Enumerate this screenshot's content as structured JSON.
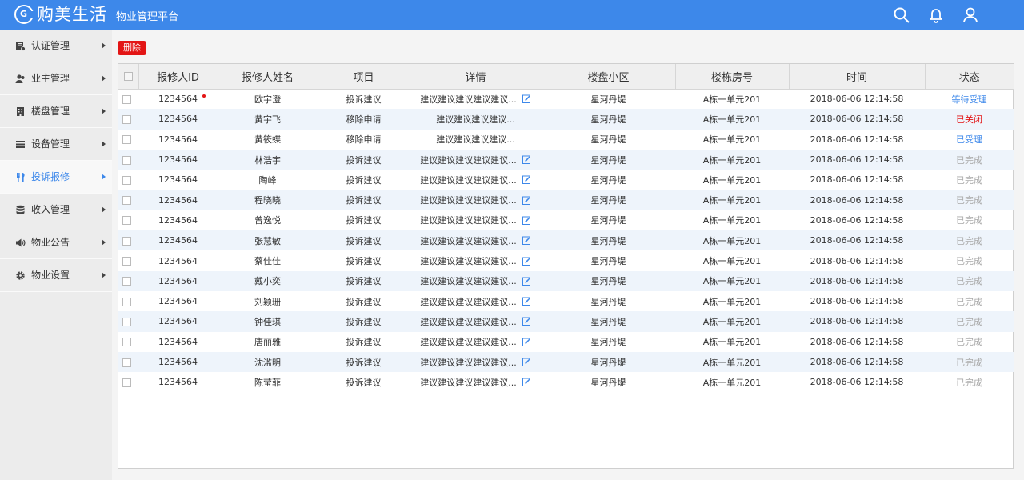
{
  "header": {
    "brand": "购美生活",
    "logo_letter": "G",
    "platform": "物业管理平台",
    "icons": [
      "search-icon",
      "bell-icon",
      "user-icon"
    ]
  },
  "sidebar": {
    "items": [
      {
        "label": "认证管理",
        "icon": "certificate-icon"
      },
      {
        "label": "业主管理",
        "icon": "users-icon"
      },
      {
        "label": "楼盘管理",
        "icon": "building-icon"
      },
      {
        "label": "设备管理",
        "icon": "device-list-icon"
      },
      {
        "label": "投诉报修",
        "icon": "tools-icon",
        "active": true
      },
      {
        "label": "收入管理",
        "icon": "database-icon"
      },
      {
        "label": "物业公告",
        "icon": "speaker-icon"
      },
      {
        "label": "物业设置",
        "icon": "gear-icon"
      }
    ]
  },
  "toolbar": {
    "delete_label": "删除"
  },
  "table": {
    "columns": [
      "报修人ID",
      "报修人姓名",
      "项目",
      "详情",
      "楼盘小区",
      "楼栋房号",
      "时间",
      "状态"
    ],
    "rows": [
      {
        "id": "1234564",
        "name": "欧宇澄",
        "item": "投诉建议",
        "detail": "建议建议建议建议建议...",
        "estate": "星河丹堤",
        "room": "A栋一单元201",
        "time": "2018-06-06 12:14:58",
        "status": "等待受理",
        "status_type": "pending",
        "edit": true,
        "dot": true
      },
      {
        "id": "1234564",
        "name": "黄宇飞",
        "item": "移除申请",
        "detail": "建议建议建议建议...",
        "estate": "星河丹堤",
        "room": "A栋一单元201",
        "time": "2018-06-06 12:14:58",
        "status": "已关闭",
        "status_type": "closed",
        "edit": false
      },
      {
        "id": "1234564",
        "name": "黄筱蝶",
        "item": "移除申请",
        "detail": "建议建议建议建议...",
        "estate": "星河丹堤",
        "room": "A栋一单元201",
        "time": "2018-06-06 12:14:58",
        "status": "已受理",
        "status_type": "accepted",
        "edit": false
      },
      {
        "id": "1234564",
        "name": "林浩宇",
        "item": "投诉建议",
        "detail": "建议建议建议建议建议...",
        "estate": "星河丹堤",
        "room": "A栋一单元201",
        "time": "2018-06-06 12:14:58",
        "status": "已完成",
        "status_type": "done",
        "edit": true
      },
      {
        "id": "1234564",
        "name": "陶峰",
        "item": "投诉建议",
        "detail": "建议建议建议建议建议...",
        "estate": "星河丹堤",
        "room": "A栋一单元201",
        "time": "2018-06-06 12:14:58",
        "status": "已完成",
        "status_type": "done",
        "edit": true
      },
      {
        "id": "1234564",
        "name": "程晓晓",
        "item": "投诉建议",
        "detail": "建议建议建议建议建议...",
        "estate": "星河丹堤",
        "room": "A栋一单元201",
        "time": "2018-06-06 12:14:58",
        "status": "已完成",
        "status_type": "done",
        "edit": true
      },
      {
        "id": "1234564",
        "name": "曾逸悦",
        "item": "投诉建议",
        "detail": "建议建议建议建议建议...",
        "estate": "星河丹堤",
        "room": "A栋一单元201",
        "time": "2018-06-06 12:14:58",
        "status": "已完成",
        "status_type": "done",
        "edit": true
      },
      {
        "id": "1234564",
        "name": "张慧敏",
        "item": "投诉建议",
        "detail": "建议建议建议建议建议...",
        "estate": "星河丹堤",
        "room": "A栋一单元201",
        "time": "2018-06-06 12:14:58",
        "status": "已完成",
        "status_type": "done",
        "edit": true
      },
      {
        "id": "1234564",
        "name": "蔡佳佳",
        "item": "投诉建议",
        "detail": "建议建议建议建议建议...",
        "estate": "星河丹堤",
        "room": "A栋一单元201",
        "time": "2018-06-06 12:14:58",
        "status": "已完成",
        "status_type": "done",
        "edit": true
      },
      {
        "id": "1234564",
        "name": "戴小奕",
        "item": "投诉建议",
        "detail": "建议建议建议建议建议...",
        "estate": "星河丹堤",
        "room": "A栋一单元201",
        "time": "2018-06-06 12:14:58",
        "status": "已完成",
        "status_type": "done",
        "edit": true
      },
      {
        "id": "1234564",
        "name": "刘颖珊",
        "item": "投诉建议",
        "detail": "建议建议建议建议建议...",
        "estate": "星河丹堤",
        "room": "A栋一单元201",
        "time": "2018-06-06 12:14:58",
        "status": "已完成",
        "status_type": "done",
        "edit": true
      },
      {
        "id": "1234564",
        "name": "钟佳琪",
        "item": "投诉建议",
        "detail": "建议建议建议建议建议...",
        "estate": "星河丹堤",
        "room": "A栋一单元201",
        "time": "2018-06-06 12:14:58",
        "status": "已完成",
        "status_type": "done",
        "edit": true
      },
      {
        "id": "1234564",
        "name": "唐丽雅",
        "item": "投诉建议",
        "detail": "建议建议建议建议建议...",
        "estate": "星河丹堤",
        "room": "A栋一单元201",
        "time": "2018-06-06 12:14:58",
        "status": "已完成",
        "status_type": "done",
        "edit": true
      },
      {
        "id": "1234564",
        "name": "沈滥明",
        "item": "投诉建议",
        "detail": "建议建议建议建议建议...",
        "estate": "星河丹堤",
        "room": "A栋一单元201",
        "time": "2018-06-06 12:14:58",
        "status": "已完成",
        "status_type": "done",
        "edit": true
      },
      {
        "id": "1234564",
        "name": "陈莹菲",
        "item": "投诉建议",
        "detail": "建议建议建议建议建议...",
        "estate": "星河丹堤",
        "room": "A栋一单元201",
        "time": "2018-06-06 12:14:58",
        "status": "已完成",
        "status_type": "done",
        "edit": true
      }
    ]
  },
  "colors": {
    "accent": "#3d88ea",
    "danger": "#e31515",
    "done": "#aaaaaa"
  }
}
